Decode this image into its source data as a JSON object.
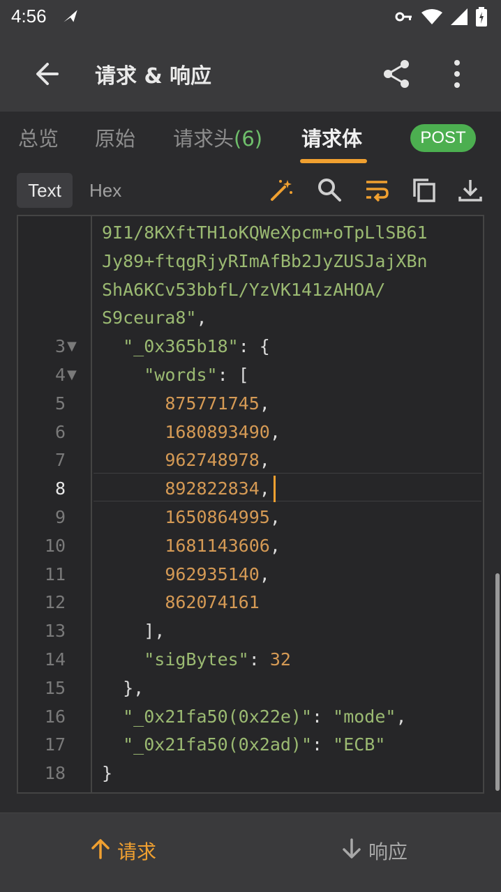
{
  "status": {
    "time": "4:56"
  },
  "appbar": {
    "title": "请求 & 响应"
  },
  "tabs": [
    {
      "label": "总览"
    },
    {
      "label": "原始"
    },
    {
      "label": "请求头",
      "count": "(6)"
    },
    {
      "label": "请求体"
    }
  ],
  "method_badge": "POST",
  "view_modes": {
    "text": "Text",
    "hex": "Hex"
  },
  "code": {
    "wrapped_lines": [
      "9I1/8KXftTH1oKQWeXpcm+oTpLlSB61",
      "Jy89+ftqgRjyRImAfBb2JyZUSJajXBn",
      "ShA6KCv53bbfL/YzVK141zAHOA/",
      "S9ceura8\","
    ],
    "lines": [
      {
        "n": "3",
        "fold": "▼",
        "text": "  \"_0x365b18\": {"
      },
      {
        "n": "4",
        "fold": "▼",
        "text": "    \"words\": ["
      },
      {
        "n": "5",
        "text": "      875771745,"
      },
      {
        "n": "6",
        "text": "      1680893490,"
      },
      {
        "n": "7",
        "text": "      962748978,"
      },
      {
        "n": "8",
        "text": "      892822834,"
      },
      {
        "n": "9",
        "text": "      1650864995,"
      },
      {
        "n": "10",
        "text": "      1681143606,"
      },
      {
        "n": "11",
        "text": "      962935140,"
      },
      {
        "n": "12",
        "text": "      862074161"
      },
      {
        "n": "13",
        "text": "    ],"
      },
      {
        "n": "14",
        "text": "    \"sigBytes\": 32"
      },
      {
        "n": "15",
        "text": "  },"
      },
      {
        "n": "16",
        "text": "  \"_0x21fa50(0x22e)\": \"mode\","
      },
      {
        "n": "17",
        "text": "  \"_0x21fa50(0x2ad)\": \"ECB\""
      },
      {
        "n": "18",
        "text": "}"
      }
    ],
    "current_line": "8"
  },
  "bottom": {
    "request": "请求",
    "response": "响应"
  },
  "colors": {
    "accent": "#f0a030",
    "string": "#9bba72",
    "number": "#d59a55",
    "badge": "#4caf50"
  }
}
